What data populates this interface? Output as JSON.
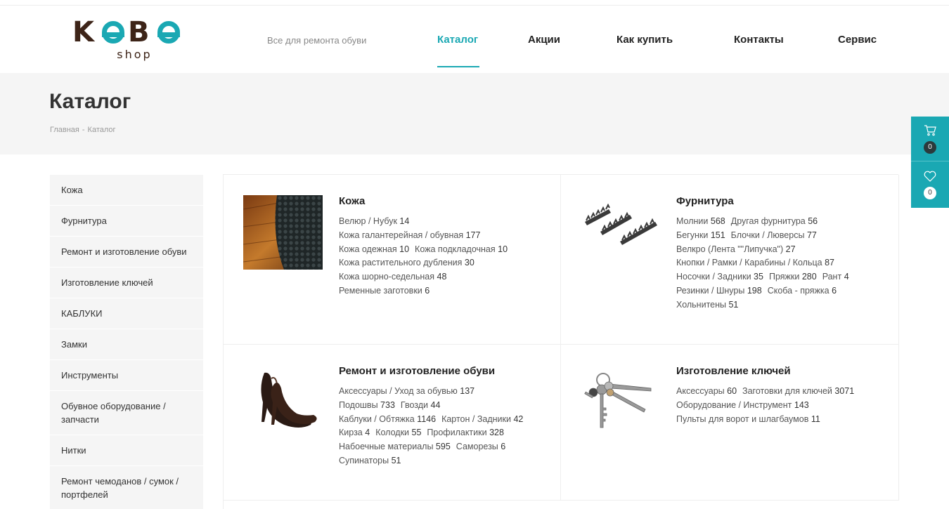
{
  "header": {
    "logo_text": "KOBO",
    "logo_sub": "shop",
    "tagline": "Все для ремонта обуви",
    "nav": [
      "Каталог",
      "Акции",
      "Как купить",
      "Контакты",
      "Сервис"
    ],
    "accent_color": "#1aa8b3"
  },
  "page": {
    "title": "Каталог",
    "breadcrumb": [
      "Главная",
      "-",
      "Каталог"
    ]
  },
  "float_panel": {
    "cart_icon": "cart-icon",
    "cart_count": "0",
    "fav_icon": "heart-icon",
    "fav_count": "0"
  },
  "sidebar": {
    "items": [
      "Кожа",
      "Фурнитура",
      "Ремонт и изготовление обуви",
      "Изготовление ключей",
      "КАБЛУКИ",
      "Замки",
      "Инструменты",
      "Обувное оборудование / запчасти",
      "Нитки",
      "Ремонт чемоданов / сумок / портфелей"
    ]
  },
  "catalog": [
    {
      "title": "Кожа",
      "image": "leather-image",
      "links": [
        {
          "name": "Велюр / Нубук",
          "count": "14"
        },
        {
          "name": "Кожа галантерейная / обувная",
          "count": "177"
        },
        {
          "name": "Кожа одежная",
          "count": "10"
        },
        {
          "name": "Кожа подкладочная",
          "count": "10"
        },
        {
          "name": "Кожа растительного дубления",
          "count": "30"
        },
        {
          "name": "Кожа шорно-седельная",
          "count": "48"
        },
        {
          "name": "Ременные заготовки ",
          "count": "6"
        }
      ]
    },
    {
      "title": "Фурнитура",
      "image": "zipper-image",
      "links": [
        {
          "name": "Молнии",
          "count": "568"
        },
        {
          "name": "Другая фурнитура",
          "count": "56"
        },
        {
          "name": "Бегунки",
          "count": "151"
        },
        {
          "name": "Блочки / Люверсы",
          "count": "77"
        },
        {
          "name": "Велкро (Лента \"\"Липучка\")",
          "count": "27"
        },
        {
          "name": "Кнопки / Рамки / Карабины / Кольца",
          "count": "87"
        },
        {
          "name": "Носочки / Задники",
          "count": "35"
        },
        {
          "name": "Пряжки",
          "count": "280"
        },
        {
          "name": "Рант",
          "count": "4"
        },
        {
          "name": "Резинки / Шнуры",
          "count": "198"
        },
        {
          "name": "Скоба - пряжка",
          "count": "6"
        },
        {
          "name": "Хольнитены",
          "count": "51"
        }
      ]
    },
    {
      "title": "Ремонт и изготовление обуви",
      "image": "shoe-image",
      "links": [
        {
          "name": "Аксессуары / Уход за обувью",
          "count": "137"
        },
        {
          "name": "Подошвы",
          "count": "733"
        },
        {
          "name": "Гвозди",
          "count": "44"
        },
        {
          "name": "Каблуки / Обтяжка",
          "count": "1146"
        },
        {
          "name": "Картон / Задники",
          "count": "42"
        },
        {
          "name": "Кирза",
          "count": "4"
        },
        {
          "name": "Колодки",
          "count": "55"
        },
        {
          "name": "Профилактики",
          "count": "328"
        },
        {
          "name": "Набоечные материалы",
          "count": "595"
        },
        {
          "name": "Саморезы",
          "count": "6"
        },
        {
          "name": "Супинаторы",
          "count": "51"
        }
      ]
    },
    {
      "title": "Изготовление ключей",
      "image": "keys-image",
      "links": [
        {
          "name": "Аксессуары",
          "count": "60"
        },
        {
          "name": "Заготовки для ключей",
          "count": "3071"
        },
        {
          "name": "Оборудование / Инструмент",
          "count": "143"
        },
        {
          "name": "Пульты для ворот и шлагбаумов",
          "count": "11"
        }
      ]
    }
  ]
}
